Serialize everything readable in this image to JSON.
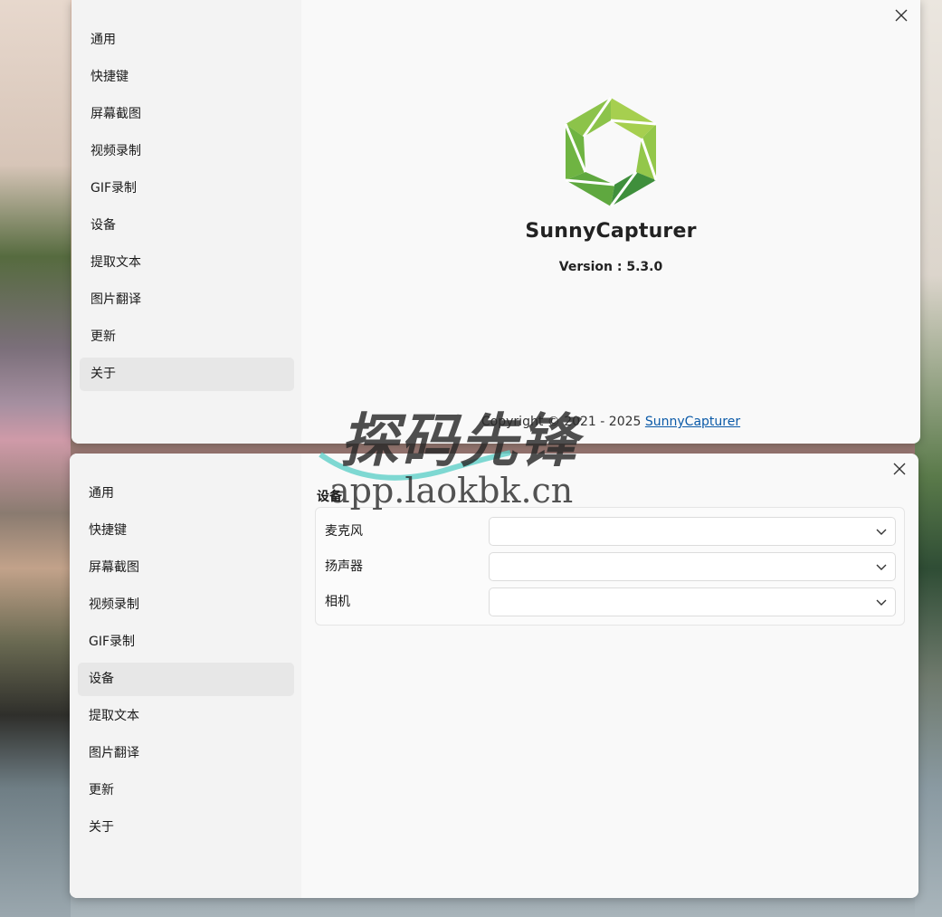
{
  "nav_items": [
    "通用",
    "快捷键",
    "屏幕截图",
    "视频录制",
    "GIF录制",
    "设备",
    "提取文本",
    "图片翻译",
    "更新",
    "关于"
  ],
  "about": {
    "app_name": "SunnyCapturer",
    "version_label": "Version : 5.3.0",
    "copyright_prefix": "Copyright © 2021 - 2025 ",
    "copyright_link": "SunnyCapturer"
  },
  "device": {
    "section_title": "设备",
    "rows": [
      {
        "label": "麦克风",
        "value": ""
      },
      {
        "label": "扬声器",
        "value": ""
      },
      {
        "label": "相机",
        "value": ""
      }
    ]
  },
  "watermark": {
    "title": "探码先锋",
    "url": "app.laokbk.cn"
  },
  "colors": {
    "logo_green_light": "#a6cf4f",
    "logo_green_mid": "#7cb83e",
    "logo_green_dark": "#3f8f3c",
    "link": "#0b5aa8",
    "active_item_bg": "#e7e7e7"
  },
  "icons": {
    "close": "close-icon",
    "dropdown": "chevron-down-icon",
    "logo": "aperture-logo-icon"
  }
}
